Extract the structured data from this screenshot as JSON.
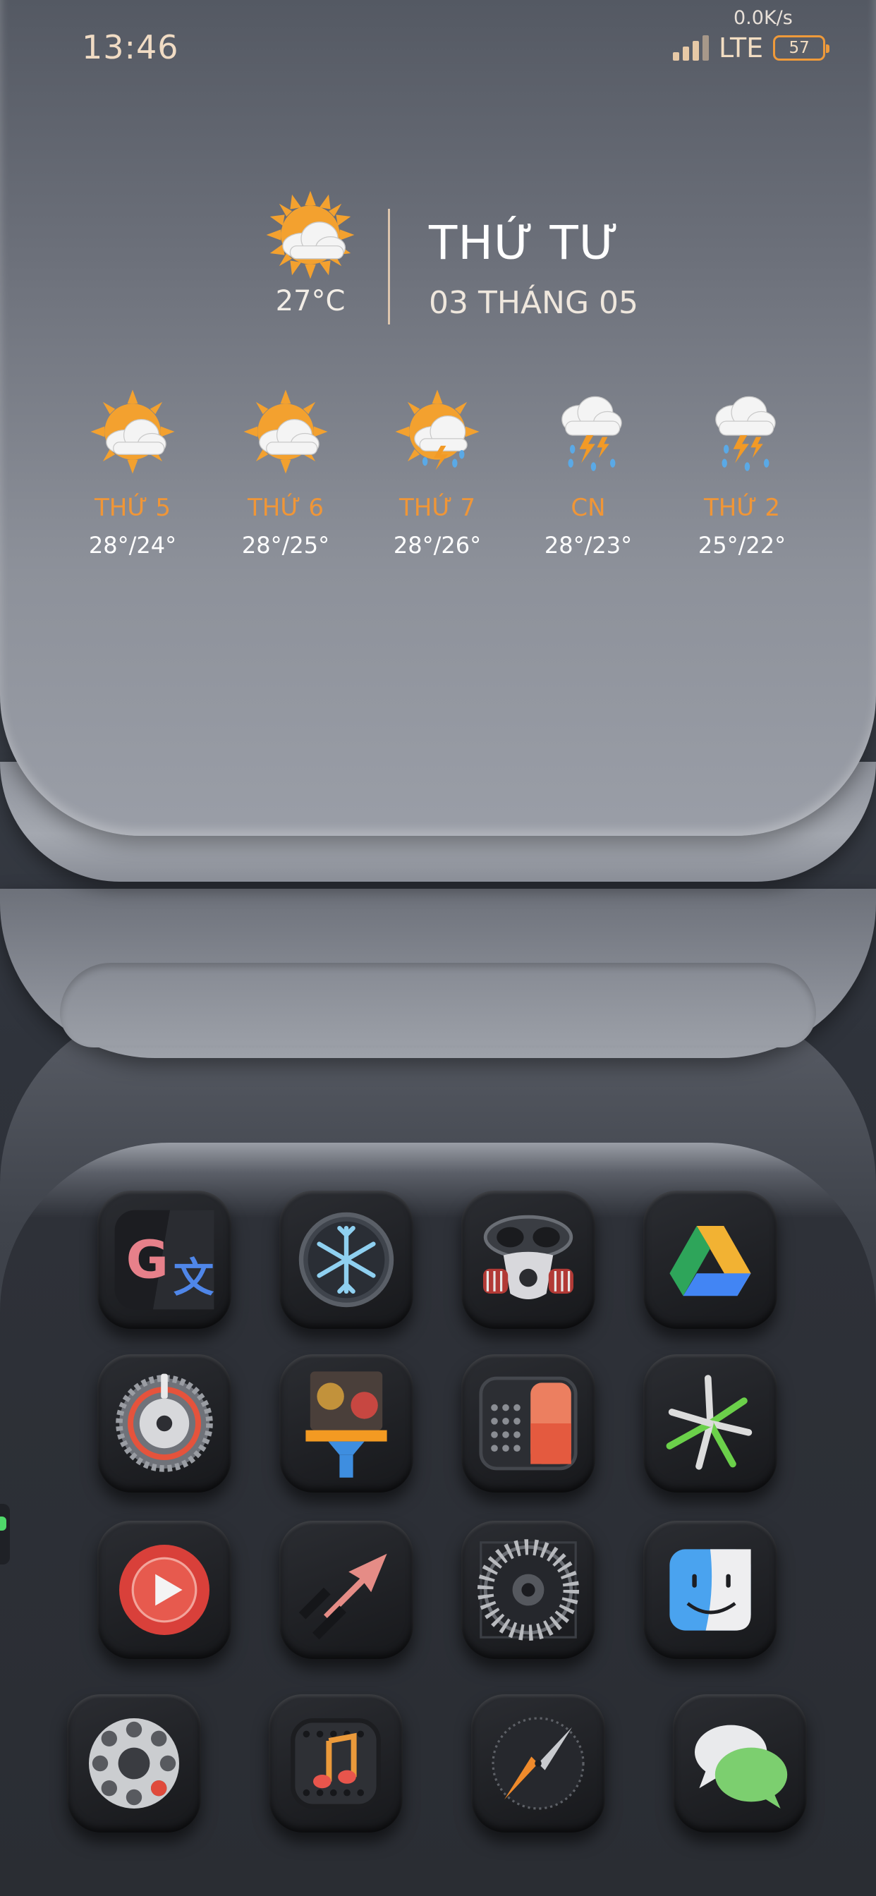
{
  "status_bar": {
    "time": "13:46",
    "net_speed": "0.0K/s",
    "network": "LTE",
    "battery": "57",
    "accent_color": "#ef9a3a"
  },
  "weather": {
    "current": {
      "icon": "partly-cloudy-icon",
      "temperature": "27°C",
      "day": "THỨ TƯ",
      "date": "03 THÁNG 05"
    },
    "forecast": [
      {
        "day": "THỨ 5",
        "temp": "28°/24°",
        "icon": "partly-cloudy-icon"
      },
      {
        "day": "THỨ 6",
        "temp": "28°/25°",
        "icon": "partly-cloudy-icon"
      },
      {
        "day": "THỨ 7",
        "temp": "28°/26°",
        "icon": "sun-thunder-rain-icon"
      },
      {
        "day": "CN",
        "temp": "28°/23°",
        "icon": "thunderstorm-icon"
      },
      {
        "day": "THỨ 2",
        "temp": "25°/22°",
        "icon": "thunderstorm-icon"
      }
    ],
    "day_color": "#f09637"
  },
  "apps": [
    {
      "icon": "google-translate-icon"
    },
    {
      "icon": "snowflake-icon"
    },
    {
      "icon": "gas-mask-icon"
    },
    {
      "icon": "google-drive-icon"
    },
    {
      "icon": "settings-gear-icon"
    },
    {
      "icon": "cleaner-brush-icon"
    },
    {
      "icon": "calculator-icon"
    },
    {
      "icon": "burst-icon"
    },
    {
      "icon": "play-button-icon"
    },
    {
      "icon": "arrow-icon"
    },
    {
      "icon": "turbine-icon"
    },
    {
      "icon": "finder-icon"
    },
    {
      "icon": "rotary-phone-icon"
    },
    {
      "icon": "music-icon"
    },
    {
      "icon": "compass-icon"
    },
    {
      "icon": "messages-icon"
    }
  ]
}
